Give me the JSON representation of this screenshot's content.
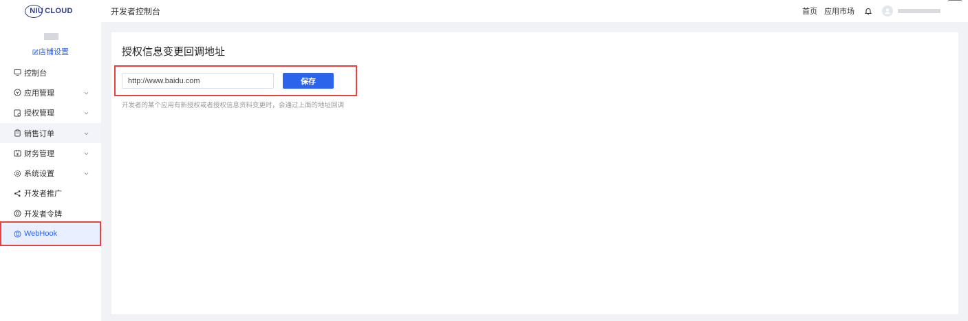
{
  "header": {
    "logo_text_niu": "NIU",
    "logo_text_cloud": "CLOUD",
    "title": "开发者控制台",
    "links": [
      "首页",
      "应用市场"
    ]
  },
  "sidebar": {
    "shop_settings": "店铺设置",
    "items": [
      {
        "label": "控制台",
        "icon": "monitor-icon",
        "expandable": false
      },
      {
        "label": "应用管理",
        "icon": "app-box-icon",
        "expandable": true
      },
      {
        "label": "授权管理",
        "icon": "authorize-icon",
        "expandable": true
      },
      {
        "label": "销售订单",
        "icon": "clipboard-icon",
        "expandable": true
      },
      {
        "label": "财务管理",
        "icon": "finance-icon",
        "expandable": true
      },
      {
        "label": "系统设置",
        "icon": "gear-icon",
        "expandable": true
      },
      {
        "label": "开发者推广",
        "icon": "share-icon",
        "expandable": false
      },
      {
        "label": "开发者令牌",
        "icon": "shield-icon",
        "expandable": false
      },
      {
        "label": "WebHook",
        "icon": "shield-icon",
        "expandable": false,
        "active": true
      }
    ]
  },
  "main": {
    "title": "授权信息变更回调地址",
    "url_value": "http://www.baidu.com",
    "save_label": "保存",
    "hint": "开发者的某个应用有新授权或者授权信息资料变更时，会通过上面的地址回调"
  },
  "colors": {
    "accent": "#2c64ec",
    "highlight_border": "#e9403f",
    "background": "#f0f2f5"
  }
}
